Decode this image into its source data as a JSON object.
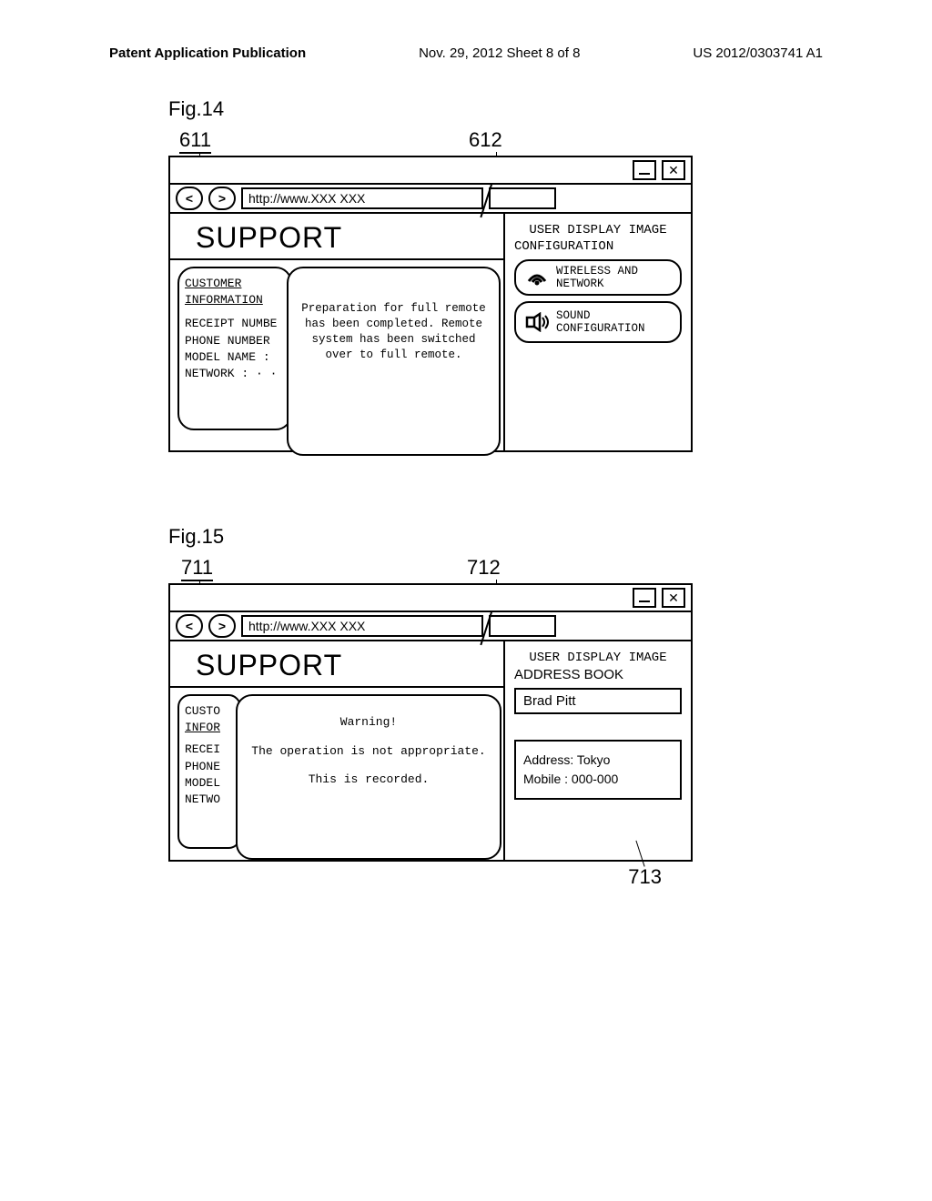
{
  "header": {
    "left": "Patent Application Publication",
    "center": "Nov. 29, 2012  Sheet 8 of 8",
    "right": "US 2012/0303741 A1"
  },
  "fig14": {
    "label": "Fig.14",
    "callout_left": "611",
    "callout_right": "612",
    "url": "http://www.XXX XXX",
    "support": "SUPPORT",
    "customer": {
      "title": "CUSTOMER INFORMATION",
      "r1": "RECEIPT NUMBE",
      "r2": "PHONE NUMBER",
      "r3": "MODEL NAME :",
      "r4": "NETWORK : · ·"
    },
    "center_msg": "Preparation for full remote has been completed.  Remote system has been switched over to full remote.",
    "right": {
      "title": "USER DISPLAY IMAGE",
      "sub": "CONFIGURATION",
      "item1": "WIRELESS AND NETWORK",
      "item2a": "SOUND",
      "item2b": "CONFIGURATION"
    }
  },
  "fig15": {
    "label": "Fig.15",
    "callout_left": "711",
    "callout_right": "712",
    "callout_bottom": "713",
    "url": "http://www.XXX XXX",
    "support": "SUPPORT",
    "customer": {
      "title1": "CUSTO",
      "title2": "INFOR",
      "r1": "RECEI",
      "r2": "PHONE",
      "r3": "MODEL",
      "r4": "NETWO"
    },
    "warn_title": "Warning!",
    "warn_l1": "The operation is not appropriate.",
    "warn_l2": "This is recorded.",
    "right": {
      "title": "USER DISPLAY IMAGE",
      "sub": "ADDRESS BOOK",
      "name": "Brad Pitt",
      "addr": "Address: Tokyo",
      "mobile": "Mobile  : 000-000"
    }
  }
}
